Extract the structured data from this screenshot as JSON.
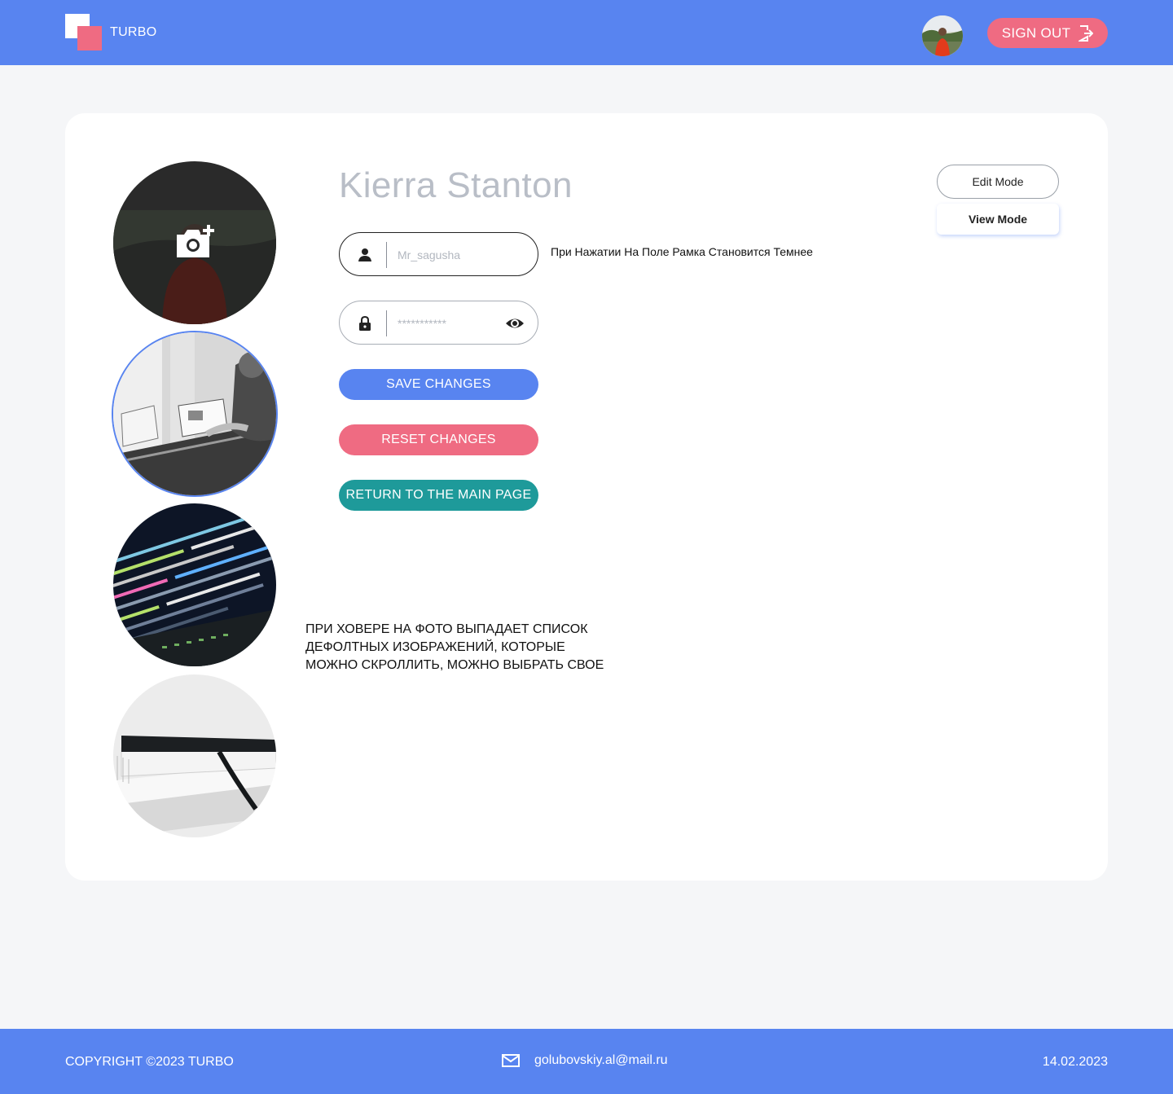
{
  "header": {
    "logo_text": "TURBO",
    "sign_out_label": "SIGN OUT",
    "accent_color": "#5884f0",
    "pink_color": "#ef6b82"
  },
  "profile": {
    "name": "Kierra Stanton",
    "username_placeholder": "Mr_sagusha",
    "password_placeholder": "***********",
    "field_note": "При Нажатии На Поле Рамка Становится Темнее",
    "photo_note": [
      "ПРИ ХОВЕРЕ НА ФОТО ВЫПАДАЕТ СПИСОК",
      "ДЕФОЛТНЫХ ИЗОБРАЖЕНИЙ, КОТОРЫЕ",
      "МОЖНО СКРОЛЛИТЬ, МОЖНО ВЫБРАТЬ СВОЕ"
    ]
  },
  "buttons": {
    "save": "SAVE CHANGES",
    "reset": "RESET CHANGES",
    "return": "RETURN TO THE MAIN PAGE",
    "save_color": "#5884f0",
    "reset_color": "#ef6b82",
    "return_color": "#1e9a9a"
  },
  "modes": {
    "edit": "Edit Mode",
    "view": "View Mode"
  },
  "footer": {
    "copyright": "COPYRIGHT ©2023 TURBO",
    "email": "golubovskiy.al@mail.ru",
    "date": "14.02.2023"
  }
}
